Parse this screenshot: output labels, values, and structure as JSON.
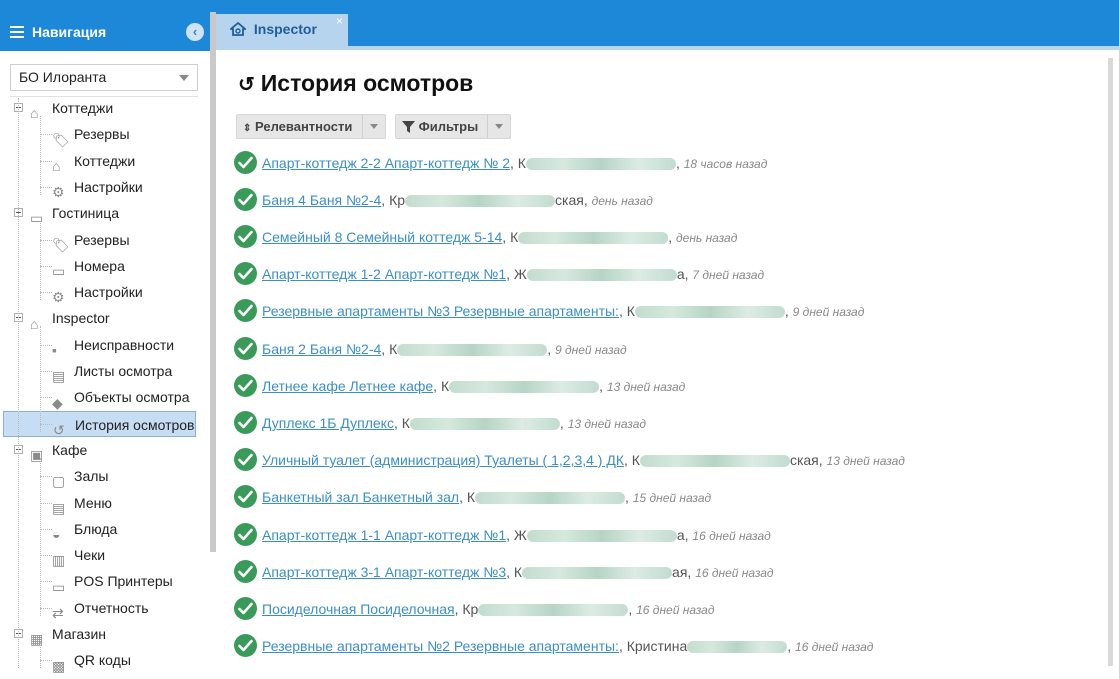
{
  "sidebar": {
    "title": "Навигация",
    "org_select": "БО Илоранта",
    "tree": [
      {
        "label": "Коттеджи",
        "level": 0,
        "icon": "home-icon"
      },
      {
        "label": "Резервы",
        "level": 1,
        "icon": "tags-icon"
      },
      {
        "label": "Коттеджи",
        "level": 1,
        "icon": "home-icon"
      },
      {
        "label": "Настройки",
        "level": 1,
        "icon": "gears-icon"
      },
      {
        "label": "Гостиница",
        "level": 0,
        "icon": "bed-icon"
      },
      {
        "label": "Резервы",
        "level": 1,
        "icon": "tags-icon"
      },
      {
        "label": "Номера",
        "level": 1,
        "icon": "bed-icon"
      },
      {
        "label": "Настройки",
        "level": 1,
        "icon": "gears-icon"
      },
      {
        "label": "Inspector",
        "level": 0,
        "icon": "home-search-icon"
      },
      {
        "label": "Неисправности",
        "level": 1,
        "icon": "comments-icon"
      },
      {
        "label": "Листы осмотра",
        "level": 1,
        "icon": "clipboard-icon"
      },
      {
        "label": "Объекты осмотра",
        "level": 1,
        "icon": "object-icon"
      },
      {
        "label": "История осмотров",
        "level": 1,
        "icon": "history-icon",
        "selected": true
      },
      {
        "label": "Кафе",
        "level": 0,
        "icon": "cafe-icon"
      },
      {
        "label": "Залы",
        "level": 1,
        "icon": "hall-icon"
      },
      {
        "label": "Меню",
        "level": 1,
        "icon": "menu-doc-icon"
      },
      {
        "label": "Блюда",
        "level": 1,
        "icon": "dish-icon"
      },
      {
        "label": "Чеки",
        "level": 1,
        "icon": "receipt-icon"
      },
      {
        "label": "POS Принтеры",
        "level": 1,
        "icon": "printer-icon"
      },
      {
        "label": "Отчетность",
        "level": 1,
        "icon": "exchange-icon"
      },
      {
        "label": "Магазин",
        "level": 0,
        "icon": "shop-icon"
      },
      {
        "label": "QR коды",
        "level": 1,
        "icon": "qr-icon"
      }
    ]
  },
  "tab": {
    "label": "Inspector",
    "close": "×"
  },
  "page": {
    "title": "История осмотров",
    "sort_button": "Релевантности",
    "filter_button": "Фильтры"
  },
  "history": [
    {
      "link": "Апарт-коттедж 2-2 Апарт-коттедж № 2",
      "name_visible": "К",
      "time": "18 часов назад"
    },
    {
      "link": "Баня 4 Баня №2-4",
      "name_visible": "Кр",
      "name_tail": "ская",
      "time": "день назад"
    },
    {
      "link": "Семейный 8 Семейный коттедж 5-14",
      "name_visible": "К",
      "time": "день назад"
    },
    {
      "link": "Апарт-коттедж 1-2 Апарт-коттедж №1",
      "name_visible": "Ж",
      "name_tail": "а",
      "time": "7 дней назад"
    },
    {
      "link": "Резервные апартаменты №3 Резервные апартаменты:",
      "name_visible": "К",
      "time": "9 дней назад"
    },
    {
      "link": "Баня 2 Баня №2-4",
      "name_visible": "К",
      "time": "9 дней назад"
    },
    {
      "link": "Летнее кафе Летнее кафе",
      "name_visible": "К",
      "time": "13 дней назад"
    },
    {
      "link": "Дуплекс 1Б Дуплекс",
      "name_visible": "К",
      "time": "13 дней назад"
    },
    {
      "link": "Уличный туалет (администрация) Туалеты ( 1,2,3,4 ) ДК",
      "name_visible": "К",
      "name_tail": "ская",
      "time": "13 дней назад"
    },
    {
      "link": "Банкетный зал Банкетный зал",
      "name_visible": "К",
      "time": "15 дней назад"
    },
    {
      "link": "Апарт-коттедж 1-1 Апарт-коттедж №1",
      "name_visible": "Ж",
      "name_tail": "а",
      "time": "16 дней назад"
    },
    {
      "link": "Апарт-коттедж 3-1 Апарт-коттедж №3",
      "name_visible": "К",
      "name_tail": "ая",
      "time": "16 дней назад"
    },
    {
      "link": "Посиделочная Посиделочная",
      "name_visible": "Кр",
      "time": "16 дней назад"
    },
    {
      "link": "Резервные апартаменты №2 Резервные апартаменты:",
      "name_visible": "Кристина",
      "time": "16 дней назад"
    }
  ],
  "colors": {
    "accent": "#1e88d8",
    "link": "#3a8fc9",
    "check": "#3a9a5a",
    "selected": "#c7ddf3"
  }
}
